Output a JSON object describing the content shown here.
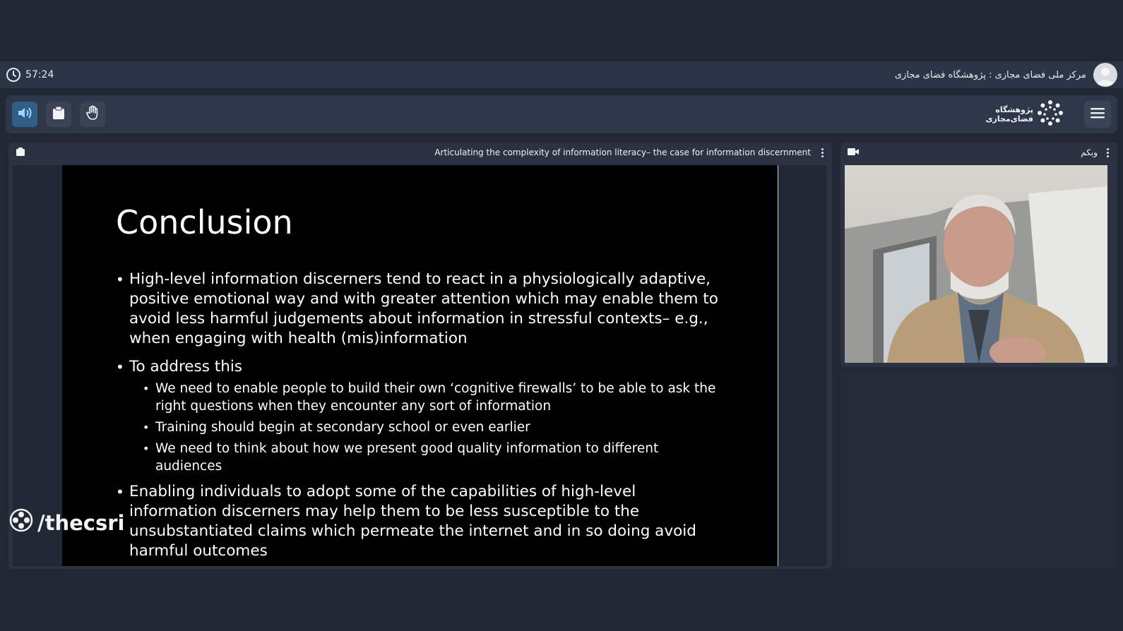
{
  "topbar": {
    "timer": "57:24",
    "room_title": "مرکز ملی فضای مجازی : پژوهشگاه فضای مجازی"
  },
  "toolbar": {
    "buttons": [
      "speaker-icon",
      "clipboard-icon",
      "raise-hand-icon"
    ],
    "logo_line1": "پژوهشگاه",
    "logo_line2": "فضای‌مجازی"
  },
  "presentation": {
    "title": "Articulating the complexity of information literacy– the case for information discernment",
    "slide": {
      "heading": "Conclusion",
      "bullet1": "High-level information discerners tend to react in a physiologically adaptive, positive emotional way and with greater attention which may enable them to avoid less harmful judgements about information in stressful contexts– e.g., when engaging with health (mis)information",
      "bullet2": "To address this",
      "sub1": "We need to enable people to build their own ‘cognitive firewalls’ to be able to ask the right questions when they encounter any sort of information",
      "sub2": "Training should begin at secondary school or even earlier",
      "sub3": "We need to think about how we present good quality information to different audiences",
      "bullet3": "Enabling individuals to adopt some of the capabilities of high-level information discerners may help them to be less susceptible to the unsubstantiated claims which permeate the internet and in so doing avoid harmful outcomes"
    }
  },
  "webcam": {
    "title": "وبکم"
  },
  "watermark": "/thecsri",
  "colors": {
    "background": "#212733",
    "panel": "#2b3343",
    "accent": "#2f5f86"
  }
}
